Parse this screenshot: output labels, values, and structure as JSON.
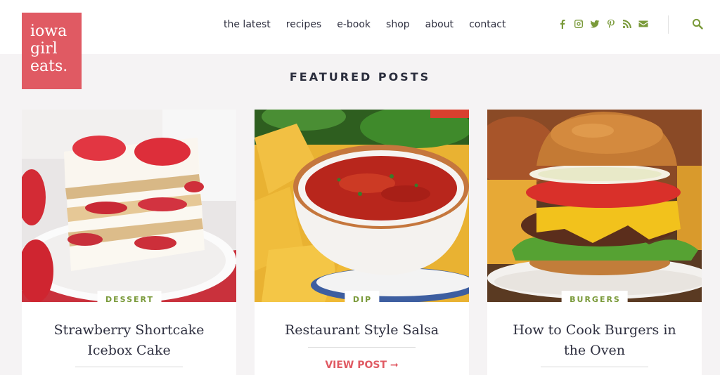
{
  "logo": {
    "lines": [
      "iowa",
      "girl",
      "eats."
    ]
  },
  "nav": {
    "items": [
      "the latest",
      "recipes",
      "e-book",
      "shop",
      "about",
      "contact"
    ]
  },
  "social": {
    "icons": [
      "facebook-icon",
      "instagram-icon",
      "twitter-icon",
      "pinterest-icon",
      "rss-icon",
      "email-icon"
    ]
  },
  "colors": {
    "brand": "#e05a63",
    "accent": "#7a9a3a",
    "background": "#f5f3f4"
  },
  "section": {
    "title": "FEATURED POSTS"
  },
  "posts": [
    {
      "category": "DESSERT",
      "title": "Strawberry Shortcake Icebox Cake"
    },
    {
      "category": "DIP",
      "title": "Restaurant Style Salsa",
      "cta": "VIEW POST ➞"
    },
    {
      "category": "BURGERS",
      "title": "How to Cook Burgers in the Oven"
    }
  ]
}
